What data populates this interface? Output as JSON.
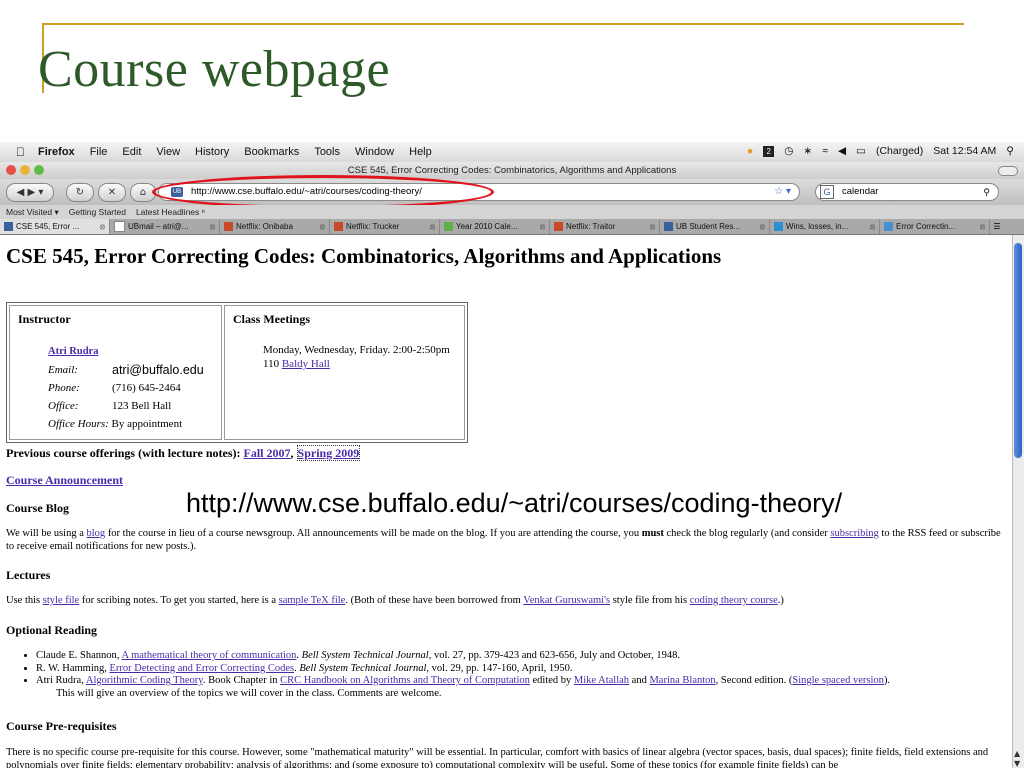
{
  "slide": {
    "title": "Course webpage",
    "overlay_url": "http://www.cse.buffalo.edu/~atri/courses/coding-theory/"
  },
  "menubar": {
    "menus": [
      "Firefox",
      "File",
      "Edit",
      "View",
      "History",
      "Bookmarks",
      "Tools",
      "Window",
      "Help"
    ],
    "battery": "(Charged)",
    "clock": "Sat 12:54 AM"
  },
  "window": {
    "title": "CSE 545, Error Correcting Codes: Combinatorics, Algorithms and Applications"
  },
  "navbar": {
    "url": "http://www.cse.buffalo.edu/~atri/courses/coding-theory/",
    "search_value": "calendar"
  },
  "bookmarks": [
    "Most Visited ▾",
    "Getting Started",
    "Latest Headlines ⁿ"
  ],
  "tabs": [
    "CSE 545, Error ...",
    "UBmail – atri@...",
    "Netflix: Onibaba",
    "Netflix: Trucker",
    "Year 2010 Cale...",
    "Netflix: Traitor",
    "UB Student Res...",
    "Wins, losses, in...",
    "Error Correctin..."
  ],
  "page": {
    "heading": "CSE 545, Error Correcting Codes: Combinatorics, Algorithms and Applications",
    "instructor": {
      "title": "Instructor",
      "name": "Atri Rudra",
      "email_label": "Email:",
      "email": "atri@buffalo.edu",
      "phone_label": "Phone:",
      "phone": "(716) 645-2464",
      "office_label": "Office:",
      "office": "123 Bell Hall",
      "hours_label": "Office Hours:",
      "hours": "By appointment"
    },
    "meetings": {
      "title": "Class Meetings",
      "time": "Monday, Wednesday, Friday. 2:00-2:50pm",
      "room_num": "110 ",
      "room_link": "Baldy Hall"
    },
    "prev": {
      "label": "Previous course offerings (with lecture notes): ",
      "fall": "Fall 2007",
      "sep": ", ",
      "spring": "Spring 2009"
    },
    "announcement": "Course Announcement",
    "blog": {
      "heading": "Course Blog",
      "p1": "We will be using a ",
      "link_blog": "blog",
      "p2": " for the course in lieu of a course newsgroup. All announcements will be made on the blog. If you are attending the course, you ",
      "must": "must",
      "p3": " check the blog regularly (and consider ",
      "link_sub": "subscribing",
      "p4": " to the RSS feed or subscribe to receive email notifications for new posts.)."
    },
    "lectures": {
      "heading": "Lectures",
      "p1": "Use this ",
      "link_style": "style file",
      "p2": " for scribing notes. To get you started, here is a ",
      "link_tex": "sample TeX file",
      "p3": ". (Both of these have been borrowed from ",
      "link_venkat": "Venkat Guruswami's",
      "p4": " style file from his ",
      "link_course": "coding theory course",
      "p5": ".)"
    },
    "optional": {
      "heading": "Optional Reading",
      "r1_a": "Claude E. Shannon, ",
      "r1_link": "A mathematical theory of communication",
      "r1_b": ". ",
      "r1_j": "Bell System Technical Journal",
      "r1_c": ", vol. 27, pp. 379-423 and 623-656, July and October, 1948.",
      "r2_a": "R. W. Hamming, ",
      "r2_link": "Error Detecting and Error Correcting Codes",
      "r2_b": ". ",
      "r2_j": "Bell System Technical Journal",
      "r2_c": ", vol. 29, pp. 147-160, April, 1950.",
      "r3_a": "Atri Rudra, ",
      "r3_link": "Algorithmic Coding Theory",
      "r3_b": ". Book Chapter in ",
      "r3_link2": "CRC Handbook on Algorithms and Theory of Computation",
      "r3_c": " edited by ",
      "r3_link3": "Mike Atallah",
      "r3_d": " and ",
      "r3_link4": "Marina Blanton",
      "r3_e": ", Second edition. (",
      "r3_link5": "Single spaced version",
      "r3_f": ").",
      "r3_note": "This will give an overview of the topics we will cover in the class. Comments are welcome."
    },
    "prereq": {
      "heading": "Course Pre-requisites",
      "text": "There is no specific course pre-requisite for this course. However, some \"mathematical maturity\" will be essential. In particular, comfort with basics of linear algebra (vector spaces, basis, dual spaces); finite fields, field extensions and polynomials over finite fields; elementary probability; analysis of algorithms; and (some exposure to) computational complexity will be useful. Some of these topics (for example finite fields) can be"
    }
  },
  "colors": {
    "link": "#4a2aa8",
    "slide_title": "#2e5a2a",
    "rule": "#c8a024",
    "annotation": "#e0121b"
  }
}
